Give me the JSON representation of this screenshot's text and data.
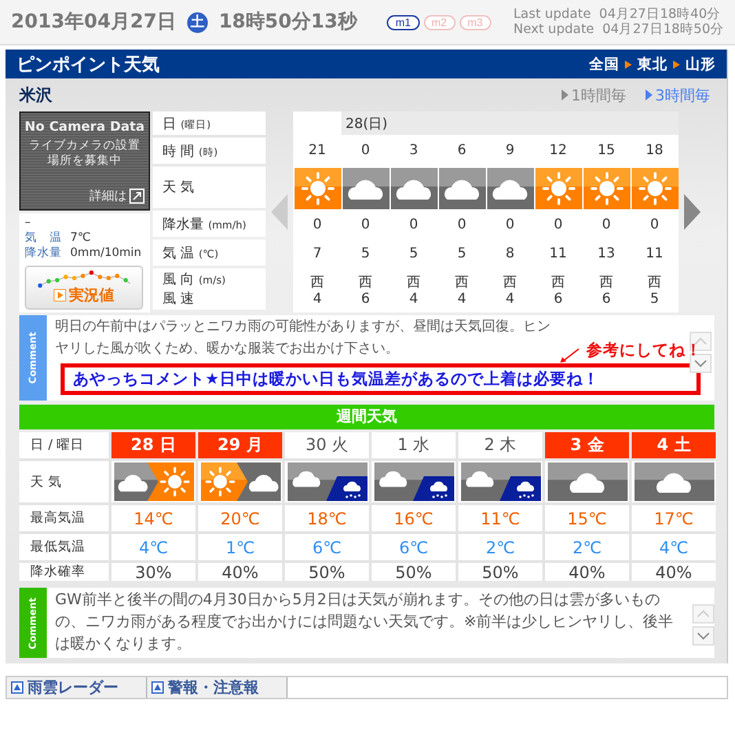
{
  "header": {
    "date": "2013年04月27日",
    "weekday": "土",
    "time": "18時50分13秒",
    "modes": [
      {
        "label": "m1",
        "selected": true
      },
      {
        "label": "m2",
        "selected": false
      },
      {
        "label": "m3",
        "selected": false
      }
    ],
    "updates": [
      {
        "label": "Last update",
        "value": "04月27日18時40分"
      },
      {
        "label": "Next update",
        "value": "04月27日18時50分"
      }
    ]
  },
  "panel": {
    "title": "ピンポイント天気",
    "breadcrumb": [
      "全国",
      "東北",
      "山形"
    ]
  },
  "location": "米沢",
  "intervals": [
    {
      "label": "1時間毎",
      "selected": false
    },
    {
      "label": "3時間毎",
      "selected": true
    }
  ],
  "camera": {
    "title": "No Camera Data",
    "message": "ライブカメラの設置場所を募集中",
    "detail": "詳細は"
  },
  "observation": {
    "station": "–",
    "rows": [
      {
        "label": "気　温",
        "value": "7℃"
      },
      {
        "label": "降水量",
        "value": "0mm/10min"
      }
    ],
    "button": "実況値"
  },
  "hourly": {
    "row_labels": [
      {
        "label": "日",
        "unit": "(曜日)"
      },
      {
        "label": "時 間",
        "unit": "(時)"
      },
      {
        "label": "天 気"
      },
      {
        "label": "降水量",
        "unit": "(mm/h)"
      },
      {
        "label": "気 温",
        "unit": "(℃)"
      },
      {
        "label": "風 向",
        "label2": "風 速",
        "unit": "(m/s)"
      }
    ],
    "day": "28(日)",
    "hours": [
      {
        "hour": "21",
        "kind": "sun",
        "precip": "0",
        "temp": "7",
        "wind_dir": "西",
        "wind_speed": "4"
      },
      {
        "hour": "0",
        "kind": "cloud",
        "precip": "0",
        "temp": "5",
        "wind_dir": "西",
        "wind_speed": "6"
      },
      {
        "hour": "3",
        "kind": "cloud",
        "precip": "0",
        "temp": "5",
        "wind_dir": "西",
        "wind_speed": "4"
      },
      {
        "hour": "6",
        "kind": "cloud",
        "precip": "0",
        "temp": "5",
        "wind_dir": "西",
        "wind_speed": "4"
      },
      {
        "hour": "9",
        "kind": "cloud",
        "precip": "0",
        "temp": "8",
        "wind_dir": "西",
        "wind_speed": "4"
      },
      {
        "hour": "12",
        "kind": "sun",
        "precip": "0",
        "temp": "11",
        "wind_dir": "西",
        "wind_speed": "6"
      },
      {
        "hour": "15",
        "kind": "sun",
        "precip": "0",
        "temp": "13",
        "wind_dir": "西",
        "wind_speed": "6"
      },
      {
        "hour": "18",
        "kind": "sun",
        "precip": "0",
        "temp": "11",
        "wind_dir": "西",
        "wind_speed": "5"
      }
    ]
  },
  "comment": {
    "label": "Comment",
    "text": "明日の午前中はパラッとニワカ雨の可能性がありますが、昼間は天気回復。ヒンヤリした風が吹くため、暖かな服装でお出かけ下さい。",
    "note": "参考にしてね！",
    "highlight": "あやっちコメント★日中は暖かい日も気温差があるので上着は必要ね！"
  },
  "weekly": {
    "title": "週間天気",
    "row_labels": [
      "日 / 曜日",
      "天 気",
      "最高気温",
      "最低気温",
      "降水確率"
    ],
    "days": [
      {
        "date": "28 日",
        "holiday": true,
        "kind": "cloud_sun",
        "max": "14℃",
        "min": "4℃",
        "pop": "30%"
      },
      {
        "date": "29 月",
        "holiday": true,
        "kind": "sun_cloud",
        "max": "20℃",
        "min": "1℃",
        "pop": "40%"
      },
      {
        "date": "30 火",
        "holiday": false,
        "kind": "cloud_rain",
        "max": "18℃",
        "min": "6℃",
        "pop": "50%"
      },
      {
        "date": "1 水",
        "holiday": false,
        "kind": "cloud_rain",
        "max": "16℃",
        "min": "6℃",
        "pop": "50%"
      },
      {
        "date": "2 木",
        "holiday": false,
        "kind": "cloud_rain",
        "max": "11℃",
        "min": "2℃",
        "pop": "50%"
      },
      {
        "date": "3 金",
        "holiday": true,
        "kind": "cloud",
        "max": "15℃",
        "min": "2℃",
        "pop": "40%"
      },
      {
        "date": "4 土",
        "holiday": true,
        "kind": "cloud",
        "max": "17℃",
        "min": "4℃",
        "pop": "40%"
      }
    ]
  },
  "comment2": {
    "label": "Comment",
    "text": "GW前半と後半の間の4月30日から5月2日は天気が崩れます。その他の日は雲が多いものの、ニワカ雨がある程度でお出かけには問題ない天気です。※前半は少しヒンヤリし、後半は暖かくなります。"
  },
  "bottom_tabs": [
    "雨雲レーダー",
    "警報・注意報"
  ]
}
